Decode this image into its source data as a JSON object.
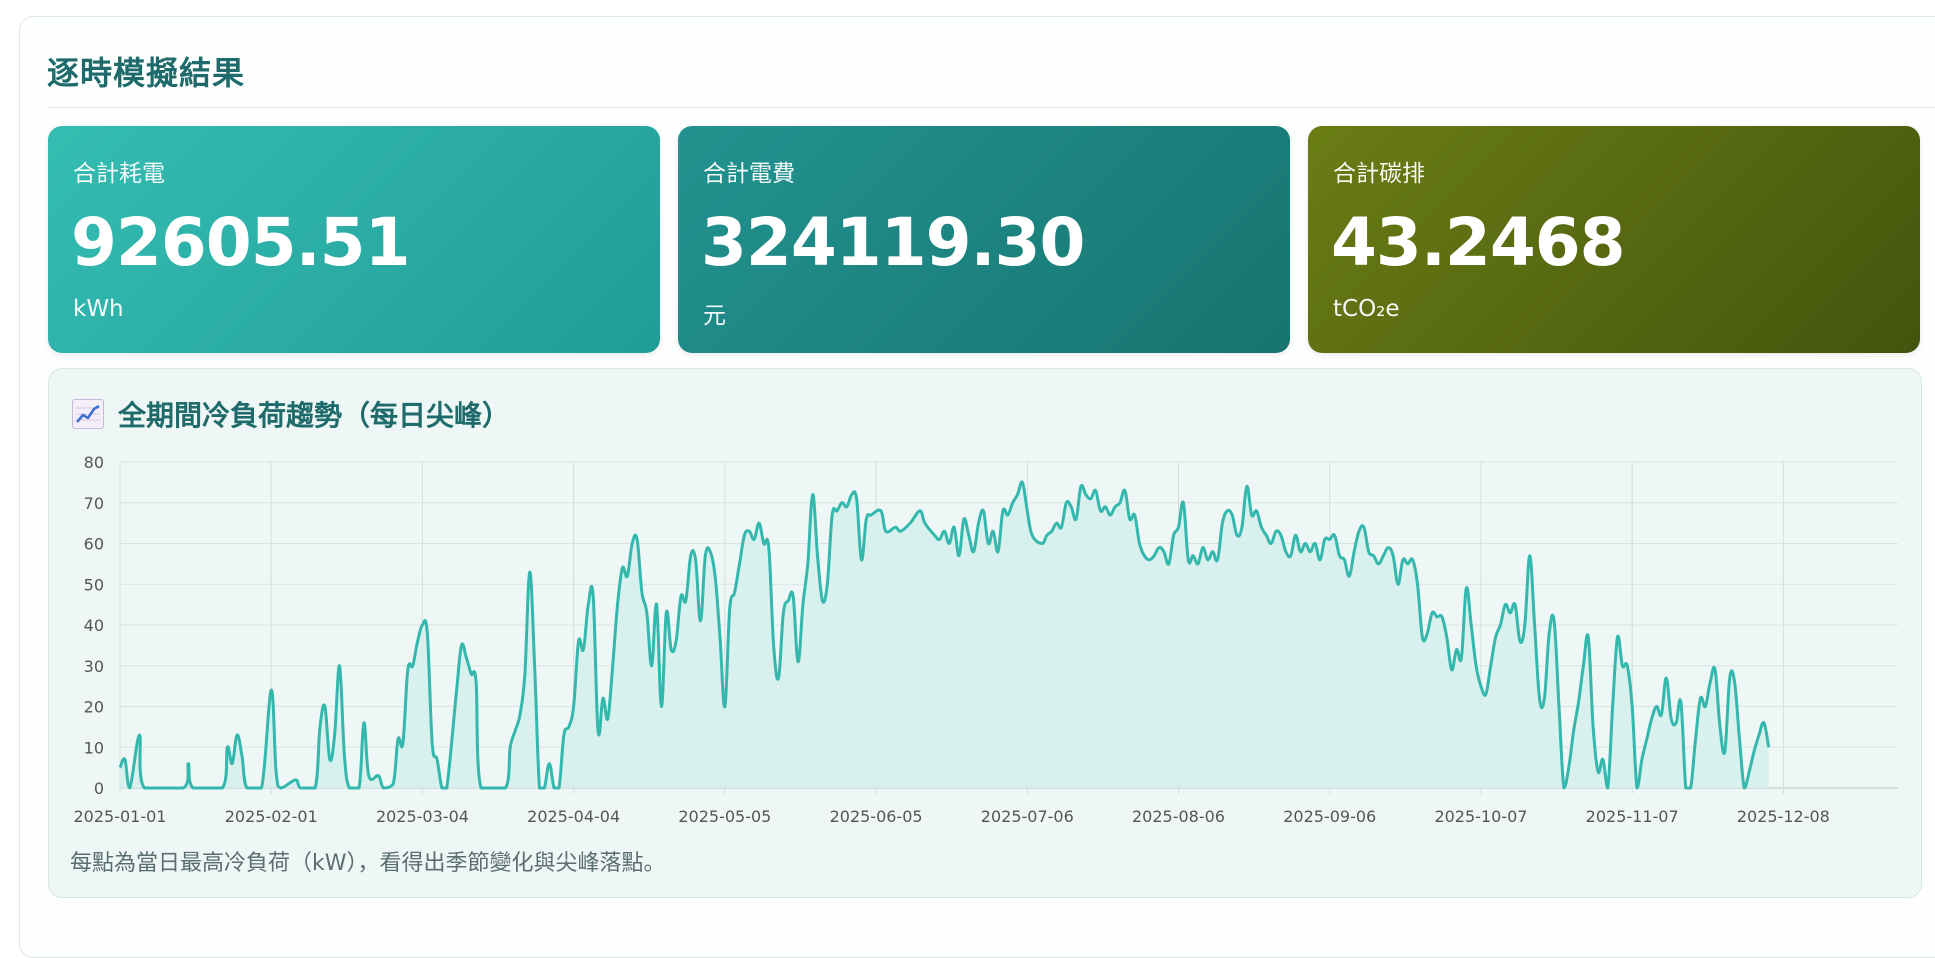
{
  "page_title": "逐時模擬結果",
  "cards": [
    {
      "label": "合計耗電",
      "value": "92605.51",
      "unit": "kWh"
    },
    {
      "label": "合計電費",
      "value": "324119.30",
      "unit": "元"
    },
    {
      "label": "合計碳排",
      "value": "43.2468",
      "unit": "tCO₂e"
    }
  ],
  "chart_section": {
    "title": "全期間冷負荷趨勢（每日尖峰）",
    "icon": "chart-increasing-icon",
    "note": "每點為當日最高冷負荷（kW），看得出季節變化與尖峰落點。"
  },
  "colors": {
    "title": "#1f6b6b",
    "line": "#34b8ad",
    "fill": "#d4eeec",
    "card_1": "#2aafa7",
    "card_2": "#1d8684",
    "card_3": "#566a12"
  },
  "chart_data": {
    "type": "area",
    "title": "",
    "xlabel": "",
    "ylabel": "",
    "ylim": [
      0,
      80
    ],
    "yticks": [
      0,
      10,
      20,
      30,
      40,
      50,
      60,
      70,
      80
    ],
    "xtick_labels": [
      "2025-01-01",
      "2025-02-01",
      "2025-03-04",
      "2025-04-04",
      "2025-05-05",
      "2025-06-05",
      "2025-07-06",
      "2025-08-06",
      "2025-09-06",
      "2025-10-07",
      "2025-11-07",
      "2025-12-08"
    ],
    "grid": true,
    "keypoints": [
      [
        1,
        5
      ],
      [
        2,
        7
      ],
      [
        3,
        0
      ],
      [
        5,
        13
      ],
      [
        6,
        0
      ],
      [
        14,
        0
      ],
      [
        15,
        6
      ],
      [
        16,
        0
      ],
      [
        22,
        0
      ],
      [
        23,
        10
      ],
      [
        24,
        6
      ],
      [
        25,
        13
      ],
      [
        26,
        8
      ],
      [
        27,
        0
      ],
      [
        30,
        0
      ],
      [
        32,
        24
      ],
      [
        33,
        4
      ],
      [
        34,
        0
      ],
      [
        37,
        2
      ],
      [
        38,
        0
      ],
      [
        41,
        0
      ],
      [
        42,
        15
      ],
      [
        43,
        20
      ],
      [
        44,
        7
      ],
      [
        45,
        13
      ],
      [
        46,
        30
      ],
      [
        47,
        8
      ],
      [
        48,
        0
      ],
      [
        50,
        0
      ],
      [
        51,
        16
      ],
      [
        52,
        3
      ],
      [
        54,
        3
      ],
      [
        55,
        0
      ],
      [
        57,
        1
      ],
      [
        58,
        12
      ],
      [
        59,
        11
      ],
      [
        60,
        29
      ],
      [
        61,
        30
      ],
      [
        62,
        36
      ],
      [
        63,
        40
      ],
      [
        64,
        38
      ],
      [
        65,
        11
      ],
      [
        66,
        7
      ],
      [
        67,
        0
      ],
      [
        68,
        0
      ],
      [
        70,
        24
      ],
      [
        71,
        35
      ],
      [
        72,
        32
      ],
      [
        73,
        28
      ],
      [
        74,
        26
      ],
      [
        75,
        0
      ],
      [
        80,
        0
      ],
      [
        81,
        10
      ],
      [
        82,
        14
      ],
      [
        83,
        18
      ],
      [
        84,
        28
      ],
      [
        85,
        53
      ],
      [
        86,
        30
      ],
      [
        87,
        0
      ],
      [
        88,
        0
      ],
      [
        89,
        6
      ],
      [
        90,
        0
      ],
      [
        91,
        0
      ],
      [
        92,
        13
      ],
      [
        93,
        15
      ],
      [
        94,
        20
      ],
      [
        95,
        36
      ],
      [
        96,
        34
      ],
      [
        97,
        45
      ],
      [
        98,
        47
      ],
      [
        99,
        14
      ],
      [
        100,
        22
      ],
      [
        101,
        17
      ],
      [
        102,
        30
      ],
      [
        103,
        45
      ],
      [
        104,
        54
      ],
      [
        105,
        52
      ],
      [
        106,
        60
      ],
      [
        107,
        61
      ],
      [
        108,
        48
      ],
      [
        109,
        43
      ],
      [
        110,
        30
      ],
      [
        111,
        45
      ],
      [
        112,
        20
      ],
      [
        113,
        43
      ],
      [
        114,
        34
      ],
      [
        115,
        36
      ],
      [
        116,
        47
      ],
      [
        117,
        46
      ],
      [
        118,
        57
      ],
      [
        119,
        56
      ],
      [
        120,
        41
      ],
      [
        121,
        57
      ],
      [
        122,
        58
      ],
      [
        123,
        52
      ],
      [
        124,
        37
      ],
      [
        125,
        20
      ],
      [
        126,
        44
      ],
      [
        127,
        48
      ],
      [
        128,
        55
      ],
      [
        129,
        62
      ],
      [
        130,
        63
      ],
      [
        131,
        61
      ],
      [
        132,
        65
      ],
      [
        133,
        60
      ],
      [
        134,
        59
      ],
      [
        135,
        35
      ],
      [
        136,
        27
      ],
      [
        137,
        43
      ],
      [
        138,
        46
      ],
      [
        139,
        47
      ],
      [
        140,
        31
      ],
      [
        141,
        45
      ],
      [
        142,
        55
      ],
      [
        143,
        72
      ],
      [
        144,
        57
      ],
      [
        145,
        46
      ],
      [
        146,
        50
      ],
      [
        147,
        67
      ],
      [
        148,
        68
      ],
      [
        149,
        70
      ],
      [
        150,
        69
      ],
      [
        151,
        72
      ],
      [
        152,
        71
      ],
      [
        153,
        56
      ],
      [
        154,
        66
      ],
      [
        155,
        67
      ],
      [
        157,
        68
      ],
      [
        158,
        63
      ],
      [
        160,
        64
      ],
      [
        161,
        63
      ],
      [
        163,
        65
      ],
      [
        165,
        68
      ],
      [
        166,
        65
      ],
      [
        168,
        62
      ],
      [
        169,
        61
      ],
      [
        170,
        63
      ],
      [
        171,
        60
      ],
      [
        172,
        64
      ],
      [
        173,
        57
      ],
      [
        174,
        66
      ],
      [
        175,
        62
      ],
      [
        176,
        58
      ],
      [
        177,
        65
      ],
      [
        178,
        68
      ],
      [
        179,
        60
      ],
      [
        180,
        63
      ],
      [
        181,
        58
      ],
      [
        182,
        68
      ],
      [
        183,
        67
      ],
      [
        184,
        70
      ],
      [
        185,
        72
      ],
      [
        186,
        75
      ],
      [
        187,
        68
      ],
      [
        188,
        62
      ],
      [
        190,
        60
      ],
      [
        191,
        62
      ],
      [
        192,
        63
      ],
      [
        193,
        65
      ],
      [
        194,
        64
      ],
      [
        195,
        70
      ],
      [
        196,
        69
      ],
      [
        197,
        66
      ],
      [
        198,
        74
      ],
      [
        199,
        72
      ],
      [
        200,
        71
      ],
      [
        201,
        73
      ],
      [
        202,
        68
      ],
      [
        203,
        69
      ],
      [
        204,
        67
      ],
      [
        205,
        69
      ],
      [
        206,
        70
      ],
      [
        207,
        73
      ],
      [
        208,
        66
      ],
      [
        209,
        67
      ],
      [
        210,
        60
      ],
      [
        211,
        57
      ],
      [
        212,
        56
      ],
      [
        213,
        57
      ],
      [
        214,
        59
      ],
      [
        215,
        58
      ],
      [
        216,
        55
      ],
      [
        217,
        62
      ],
      [
        218,
        64
      ],
      [
        219,
        70
      ],
      [
        220,
        56
      ],
      [
        221,
        57
      ],
      [
        222,
        55
      ],
      [
        223,
        59
      ],
      [
        224,
        56
      ],
      [
        225,
        58
      ],
      [
        226,
        56
      ],
      [
        227,
        65
      ],
      [
        228,
        68
      ],
      [
        229,
        67
      ],
      [
        230,
        62
      ],
      [
        231,
        64
      ],
      [
        232,
        74
      ],
      [
        233,
        67
      ],
      [
        234,
        68
      ],
      [
        235,
        64
      ],
      [
        236,
        62
      ],
      [
        237,
        60
      ],
      [
        238,
        63
      ],
      [
        239,
        62
      ],
      [
        240,
        58
      ],
      [
        241,
        57
      ],
      [
        242,
        62
      ],
      [
        243,
        58
      ],
      [
        244,
        60
      ],
      [
        245,
        58
      ],
      [
        246,
        60
      ],
      [
        247,
        56
      ],
      [
        248,
        61
      ],
      [
        249,
        61
      ],
      [
        250,
        62
      ],
      [
        251,
        57
      ],
      [
        252,
        56
      ],
      [
        253,
        52
      ],
      [
        254,
        58
      ],
      [
        255,
        63
      ],
      [
        256,
        64
      ],
      [
        257,
        58
      ],
      [
        258,
        57
      ],
      [
        259,
        55
      ],
      [
        260,
        57
      ],
      [
        261,
        59
      ],
      [
        262,
        57
      ],
      [
        263,
        50
      ],
      [
        264,
        56
      ],
      [
        265,
        55
      ],
      [
        266,
        56
      ],
      [
        267,
        50
      ],
      [
        268,
        37
      ],
      [
        269,
        38
      ],
      [
        270,
        43
      ],
      [
        271,
        42
      ],
      [
        272,
        42
      ],
      [
        273,
        37
      ],
      [
        274,
        29
      ],
      [
        275,
        34
      ],
      [
        276,
        32
      ],
      [
        277,
        49
      ],
      [
        278,
        40
      ],
      [
        279,
        30
      ],
      [
        280,
        25
      ],
      [
        281,
        23
      ],
      [
        282,
        30
      ],
      [
        283,
        37
      ],
      [
        284,
        40
      ],
      [
        285,
        45
      ],
      [
        286,
        43
      ],
      [
        287,
        45
      ],
      [
        288,
        36
      ],
      [
        289,
        40
      ],
      [
        290,
        57
      ],
      [
        291,
        40
      ],
      [
        292,
        22
      ],
      [
        293,
        22
      ],
      [
        294,
        38
      ],
      [
        295,
        41
      ],
      [
        296,
        20
      ],
      [
        297,
        0
      ],
      [
        298,
        5
      ],
      [
        299,
        14
      ],
      [
        300,
        21
      ],
      [
        301,
        30
      ],
      [
        302,
        37
      ],
      [
        303,
        15
      ],
      [
        304,
        4
      ],
      [
        305,
        7
      ],
      [
        306,
        0
      ],
      [
        307,
        20
      ],
      [
        308,
        37
      ],
      [
        309,
        30
      ],
      [
        310,
        30
      ],
      [
        311,
        20
      ],
      [
        312,
        0
      ],
      [
        313,
        7
      ],
      [
        314,
        12
      ],
      [
        315,
        17
      ],
      [
        316,
        20
      ],
      [
        317,
        18
      ],
      [
        318,
        27
      ],
      [
        319,
        17
      ],
      [
        320,
        16
      ],
      [
        321,
        21
      ],
      [
        322,
        0
      ],
      [
        323,
        0
      ],
      [
        324,
        12
      ],
      [
        325,
        22
      ],
      [
        326,
        20
      ],
      [
        327,
        26
      ],
      [
        328,
        29
      ],
      [
        329,
        15
      ],
      [
        330,
        9
      ],
      [
        331,
        27
      ],
      [
        332,
        26
      ],
      [
        333,
        12
      ],
      [
        334,
        0
      ],
      [
        335,
        4
      ],
      [
        336,
        9
      ],
      [
        337,
        13
      ],
      [
        338,
        16
      ],
      [
        339,
        10
      ]
    ]
  }
}
